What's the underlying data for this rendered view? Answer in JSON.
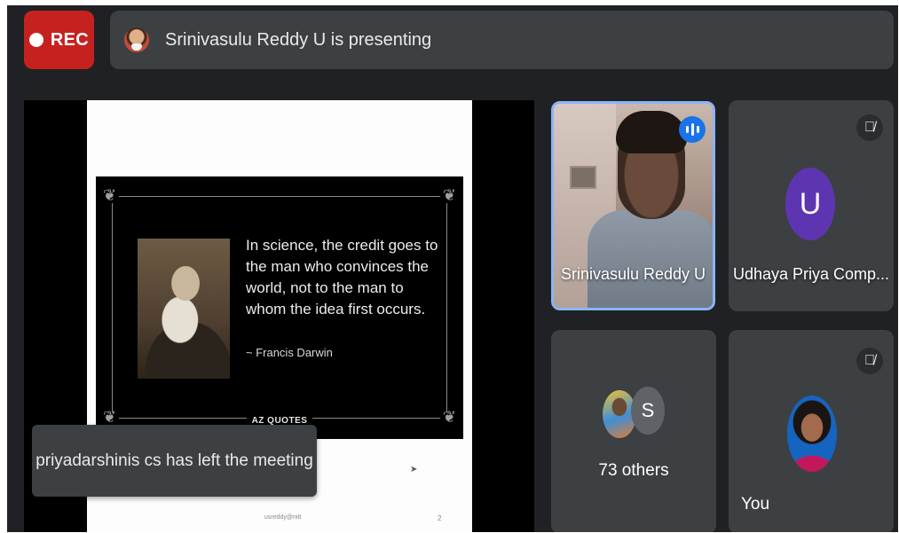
{
  "top_bar": {
    "rec_label": "REC",
    "presenting_text": "Srinivasulu Reddy U is presenting"
  },
  "slide": {
    "quote": "In science, the credit goes to the man who convinces the world, not to the man to whom the idea first occurs.",
    "author": "~ Francis Darwin",
    "brand": "AZ QUOTES",
    "footer": "usreddy@nitt",
    "page_number": "2"
  },
  "toast": {
    "message": "priyadarshinis cs has left the meeting"
  },
  "tiles": {
    "presenter": {
      "name": "Srinivasulu Reddy U",
      "speaking_icon": "audio-level-icon"
    },
    "udhaya": {
      "name": "Udhaya Priya Comp...",
      "initial": "U",
      "avatar_color": "#5e35b1",
      "muted": true
    },
    "others": {
      "label": "73 others",
      "second_initial": "S"
    },
    "you": {
      "label": "You",
      "muted": true
    }
  },
  "colors": {
    "rec": "#c5221f",
    "bar": "#3c4043",
    "background": "#202124",
    "speaking_border": "#8ab4f8",
    "speaking_badge": "#1a73e8"
  }
}
